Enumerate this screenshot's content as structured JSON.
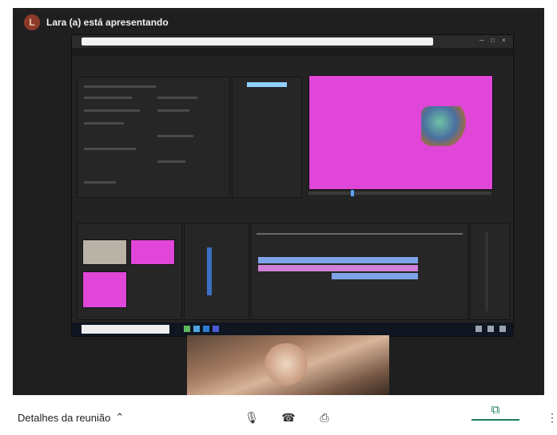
{
  "presenter": {
    "name": "Lara (a) está apresentando",
    "avatar_initial": "L"
  },
  "shared_screen": {
    "address_text": "",
    "taskbar_search_placeholder": "",
    "monitor_background": "#e046d8"
  },
  "controls": {
    "details_label": "Detalhes da reunião",
    "details_icon": "chevron-up-icon",
    "mic_icon": "microphone-icon",
    "hangup_icon": "hang-up-icon",
    "camera_icon": "video-camera-icon",
    "present_icon": "present-screen-icon",
    "more_icon": "more-vertical-icon",
    "accent_color": "#1a7f55"
  }
}
